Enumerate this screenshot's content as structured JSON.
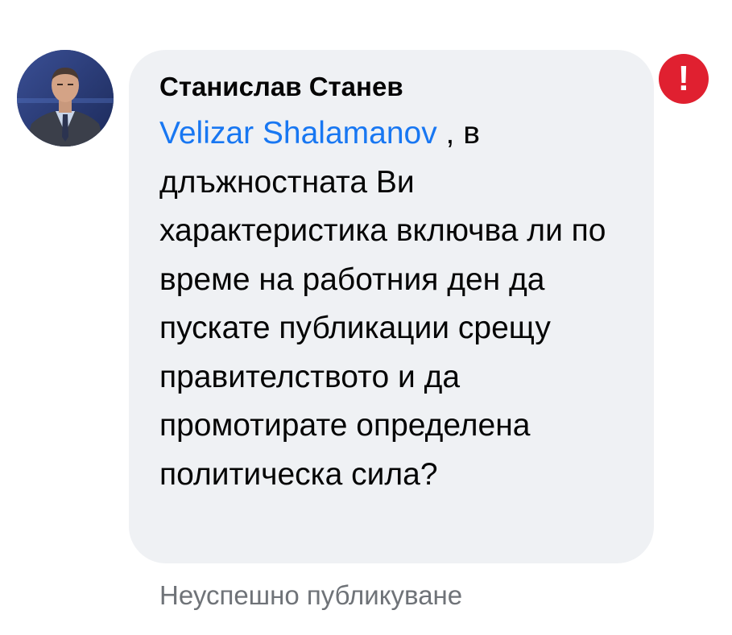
{
  "comment": {
    "author": "Станислав Станев",
    "mention": "Velizar Shalamanov",
    "text": " , в длъжностната Ви характеристика включва ли по време на работния ден да пускате публикации срещу правителството и да промотирате определена политическа сила?",
    "status": "Неуспешно публикуване",
    "error_symbol": "!"
  },
  "colors": {
    "bubble": "#eff1f4",
    "mention": "#1877f2",
    "error": "#e02030",
    "status_text": "#6f7378"
  },
  "icons": {
    "avatar": "profile-photo",
    "error": "exclamation-circle-icon"
  }
}
